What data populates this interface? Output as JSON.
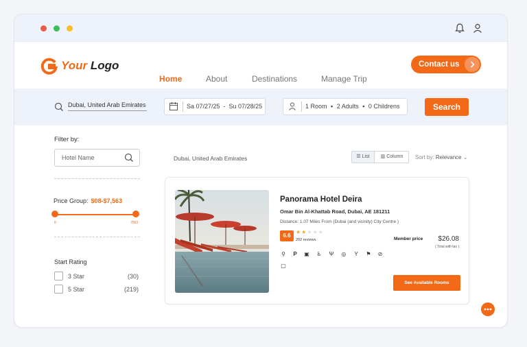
{
  "colors": {
    "accent": "#f26a17",
    "bg": "#eef2fa"
  },
  "titlebar": {
    "icons": [
      "bell-icon",
      "user-icon"
    ]
  },
  "logo": {
    "word1": "Your",
    "word2": "Logo"
  },
  "nav": {
    "items": [
      {
        "label": "Home",
        "active": true
      },
      {
        "label": "About"
      },
      {
        "label": "Destinations"
      },
      {
        "label": "Manage Trip"
      }
    ],
    "contact": "Contact us"
  },
  "search": {
    "location": "Dubai, United Arab Emirates",
    "dates": "Sa 07/27/25  -  Su 07/28/25",
    "room": "1 Room",
    "adults": "2 Adults",
    "children": "0 Childrens",
    "button": "Search"
  },
  "filters": {
    "title": "Filter by:",
    "hotel_placeholder": "Hotel Name",
    "price_label": "Price Group:",
    "price_value": "$08-$7,563",
    "slider_min": "8",
    "slider_max": "7563",
    "slider_range": [
      0.0,
      1.0
    ],
    "rating_title": "Start Rating",
    "ratings": [
      {
        "label": "3 Star",
        "count": "(30)"
      },
      {
        "label": "5 Star",
        "count": "(219)"
      }
    ]
  },
  "results": {
    "location": "Dubai, United Arab Emirates",
    "view_list": "List",
    "view_column": "Column",
    "sort_label": "Sort by:",
    "sort_value": "Relevance"
  },
  "hotel": {
    "name": "Panorama Hotel Deira",
    "address": "Omar Bin Al-Khattab Road, Dubai, AE 181211",
    "distance": "Distance: 1.07 Miles From (Dubai (and vicinity) City Centre )",
    "score": "6.6",
    "stars": 2,
    "stars_max": 5,
    "reviews": "202 reviews",
    "member_label": "Member price",
    "price": "$26.08",
    "tax": "( Total with tax )",
    "button": "See Available Rooms",
    "amenities": [
      "wifi-icon",
      "parking-icon",
      "tv-icon",
      "accessible-icon",
      "restaurant-icon",
      "laundry-icon",
      "bar-icon",
      "pet-icon",
      "no-smoking-icon",
      "safe-icon"
    ]
  }
}
